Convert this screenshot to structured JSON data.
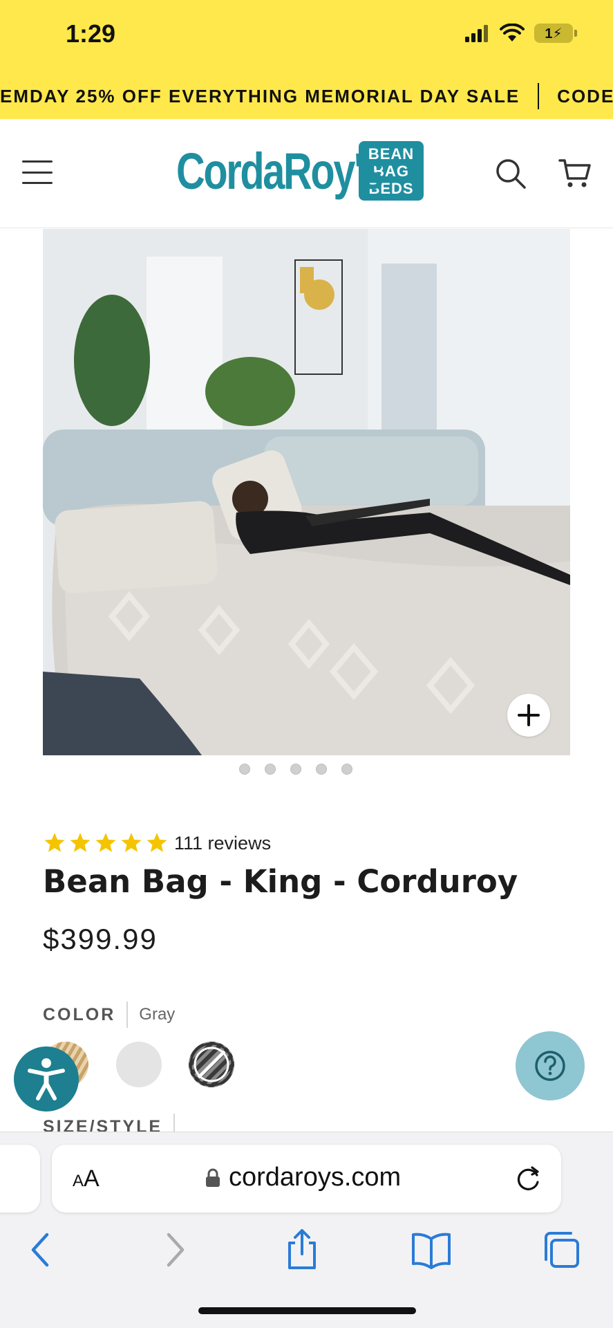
{
  "status_bar": {
    "time": "1:29",
    "battery_label": "1⚡"
  },
  "promo": {
    "text_lead": "EMDAY",
    "text_main": "25% OFF EVERYTHING MEMORIAL DAY SALE",
    "text_trail": "CODE"
  },
  "header": {
    "logo_word": "CordaRoy's",
    "logo_badge_line1": "BEAN",
    "logo_badge_line2": "BAG",
    "logo_badge_line3": "BEDS",
    "brand_color": "#1f8fa0"
  },
  "gallery": {
    "image_count": 5,
    "active_index": 0
  },
  "product": {
    "rating_stars": 5,
    "reviews_text": "111 reviews",
    "title": "Bean Bag - King - Corduroy",
    "price": "$399.99",
    "color_label": "COLOR",
    "color_value": "Gray",
    "size_label": "SIZE/STYLE",
    "star_color": "#f5c400"
  },
  "safari": {
    "aa_label": "AA",
    "url": "cordaroys.com"
  },
  "colors": {
    "promo_bg": "#fee84c",
    "accessibility_btn": "#1d7f8f",
    "help_btn": "#8ec6d2",
    "safari_accent": "#2a7bd6"
  }
}
